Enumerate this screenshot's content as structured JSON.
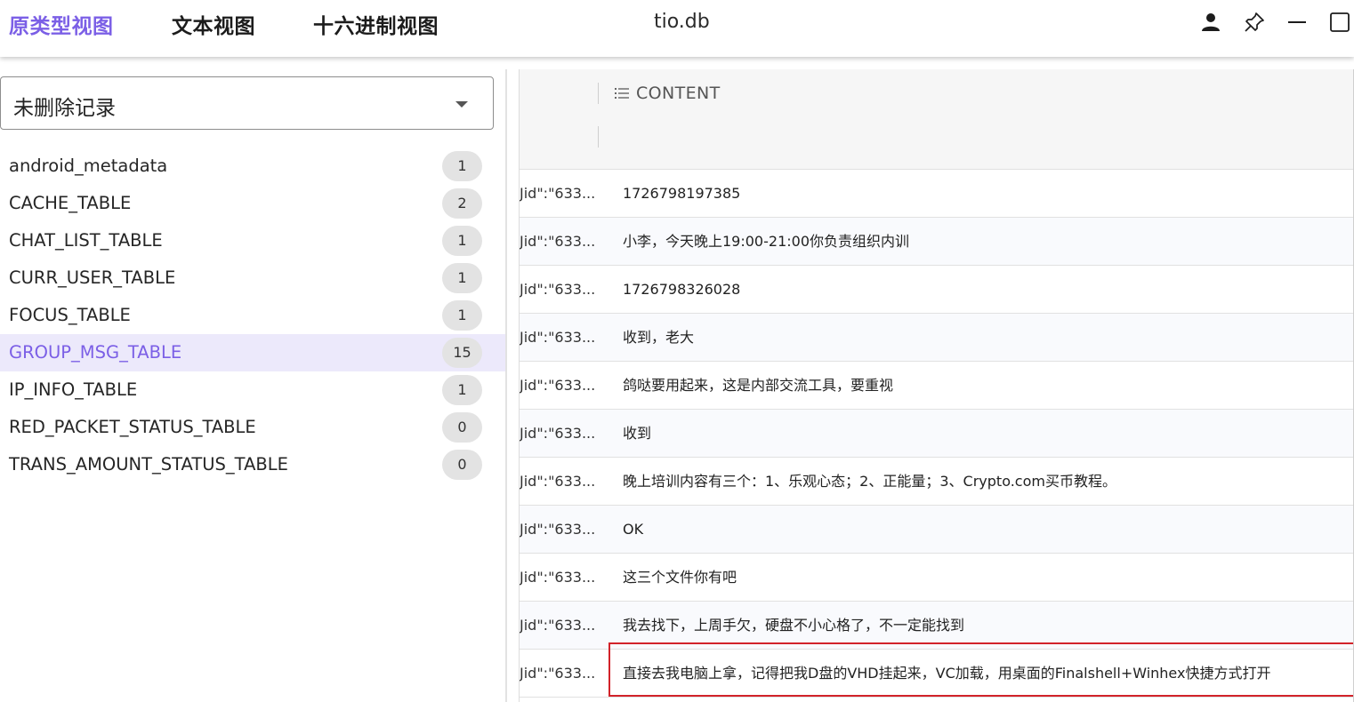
{
  "tabs": [
    {
      "label": "原类型视图",
      "active": true
    },
    {
      "label": "文本视图",
      "active": false
    },
    {
      "label": "十六进制视图",
      "active": false
    }
  ],
  "title": "tio.db",
  "window_controls": [
    "user-icon",
    "pin-icon",
    "minimize-icon",
    "maximize-icon"
  ],
  "filter": {
    "selected": "未删除记录"
  },
  "tables": [
    {
      "name": "android_metadata",
      "count": "1"
    },
    {
      "name": "CACHE_TABLE",
      "count": "2"
    },
    {
      "name": "CHAT_LIST_TABLE",
      "count": "1"
    },
    {
      "name": "CURR_USER_TABLE",
      "count": "1"
    },
    {
      "name": "FOCUS_TABLE",
      "count": "1"
    },
    {
      "name": "GROUP_MSG_TABLE",
      "count": "15",
      "selected": true
    },
    {
      "name": "IP_INFO_TABLE",
      "count": "1"
    },
    {
      "name": "RED_PACKET_STATUS_TABLE",
      "count": "0"
    },
    {
      "name": "TRANS_AMOUNT_STATUS_TABLE",
      "count": "0"
    }
  ],
  "grid": {
    "columns": [
      {
        "label": "",
        "type": "truncated"
      },
      {
        "label": "CONTENT",
        "icon": "list-icon"
      }
    ],
    "rows": [
      {
        "uid": "Jid\":\"633...",
        "content": "1726798197385"
      },
      {
        "uid": "Jid\":\"633...",
        "content": "小李，今天晚上19:00-21:00你负责组织内训"
      },
      {
        "uid": "Jid\":\"633...",
        "content": "1726798326028"
      },
      {
        "uid": "Jid\":\"633...",
        "content": "收到，老大"
      },
      {
        "uid": "Jid\":\"633...",
        "content": "鸽哒要用起来，这是内部交流工具，要重视"
      },
      {
        "uid": "Jid\":\"633...",
        "content": "收到"
      },
      {
        "uid": "Jid\":\"633...",
        "content": "晚上培训内容有三个：1、乐观心态；2、正能量；3、Crypto.com买币教程。"
      },
      {
        "uid": "Jid\":\"633...",
        "content": "OK"
      },
      {
        "uid": "Jid\":\"633...",
        "content": "这三个文件你有吧"
      },
      {
        "uid": "Jid\":\"633...",
        "content": "我去找下，上周手欠，硬盘不小心格了，不一定能找到"
      },
      {
        "uid": "Jid\":\"633...",
        "content": "直接去我电脑上拿，记得把我D盘的VHD挂起来，VC加载，用桌面的Finalshell+Winhex快捷方式打开",
        "highlighted": true
      }
    ]
  },
  "colors": {
    "accent": "#7b5fe6",
    "selected_bg": "#ece9fb",
    "highlight_border": "#d2232a"
  }
}
